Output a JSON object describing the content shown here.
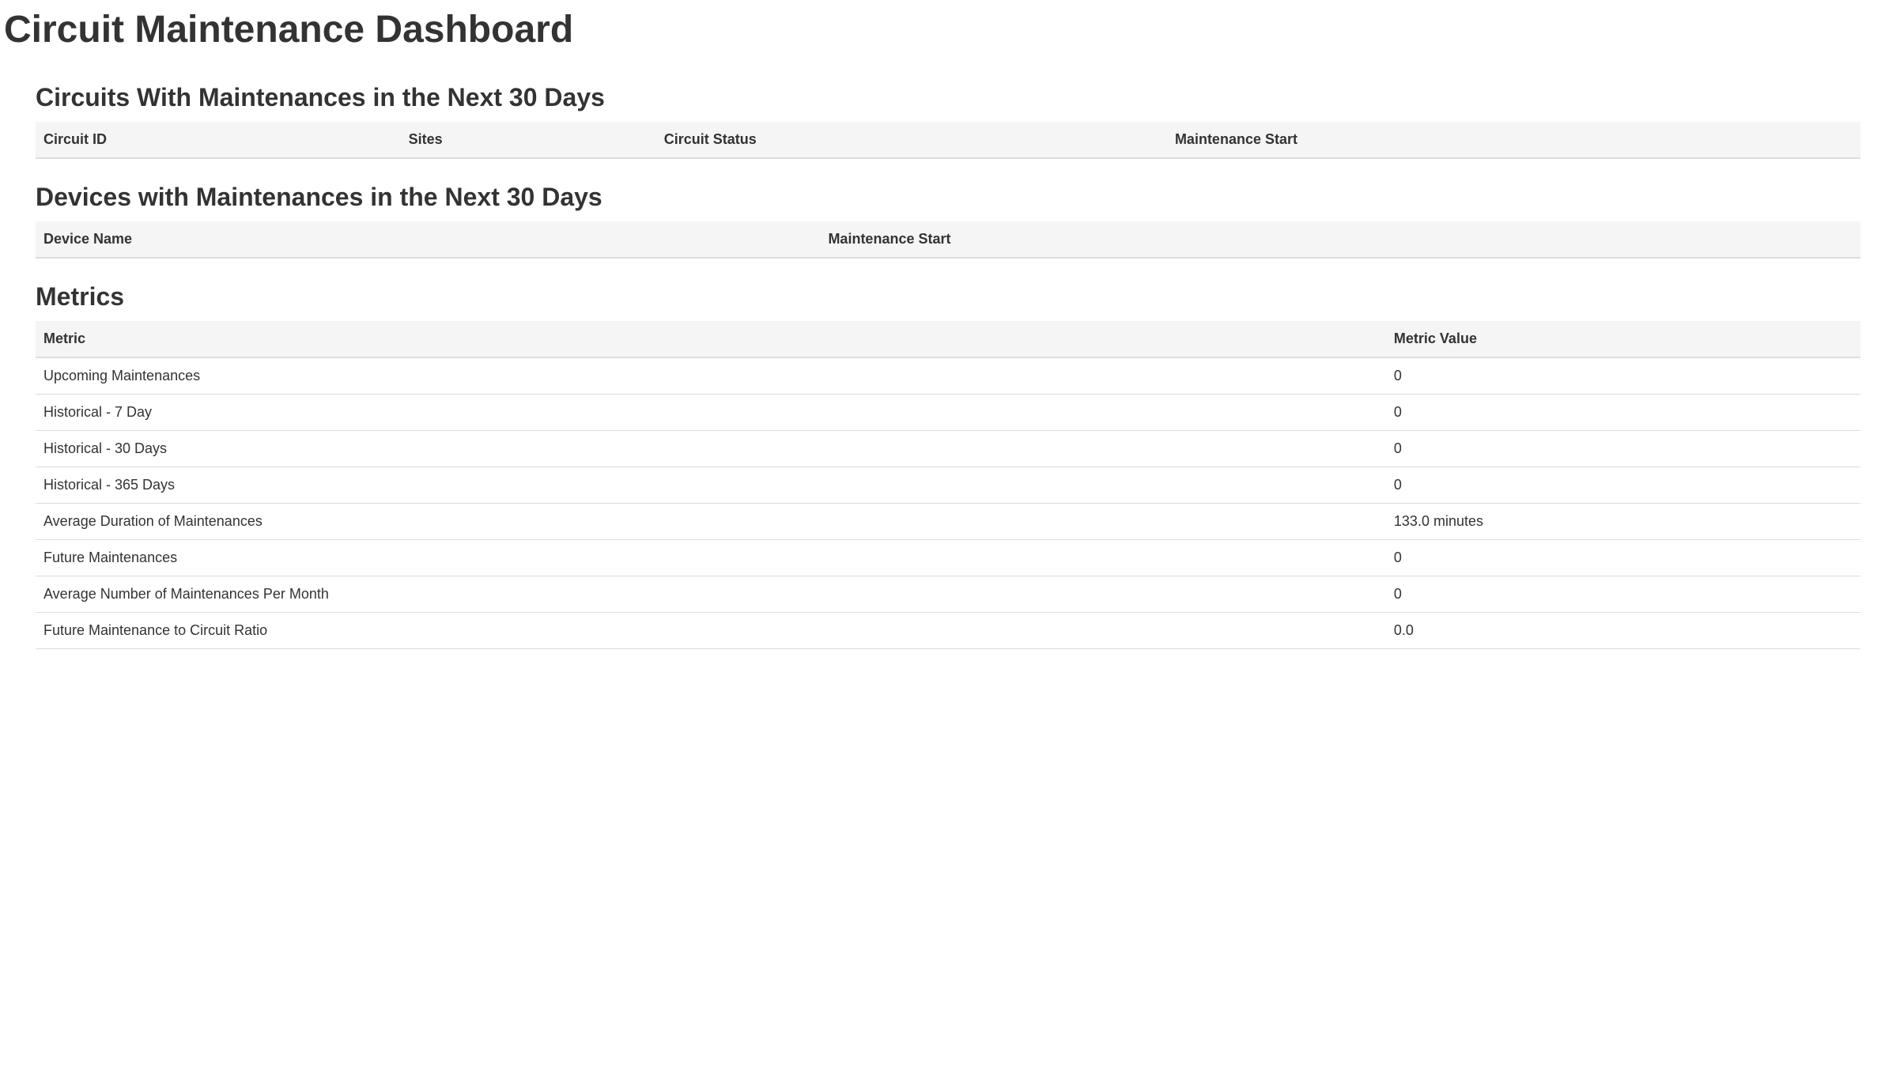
{
  "page_title": "Circuit Maintenance Dashboard",
  "sections": {
    "circuits": {
      "heading": "Circuits With Maintenances in the Next 30 Days",
      "columns": [
        "Circuit ID",
        "Sites",
        "Circuit Status",
        "Maintenance Start"
      ],
      "rows": []
    },
    "devices": {
      "heading": "Devices with Maintenances in the Next 30 Days",
      "columns": [
        "Device Name",
        "Maintenance Start"
      ],
      "rows": []
    },
    "metrics": {
      "heading": "Metrics",
      "columns": [
        "Metric",
        "Metric Value"
      ],
      "rows": [
        {
          "metric": "Upcoming Maintenances",
          "value": "0"
        },
        {
          "metric": "Historical - 7 Day",
          "value": "0"
        },
        {
          "metric": "Historical - 30 Days",
          "value": "0"
        },
        {
          "metric": "Historical - 365 Days",
          "value": "0"
        },
        {
          "metric": "Average Duration of Maintenances",
          "value": "133.0 minutes"
        },
        {
          "metric": "Future Maintenances",
          "value": "0"
        },
        {
          "metric": "Average Number of Maintenances Per Month",
          "value": "0"
        },
        {
          "metric": "Future Maintenance to Circuit Ratio",
          "value": "0.0"
        }
      ]
    }
  }
}
